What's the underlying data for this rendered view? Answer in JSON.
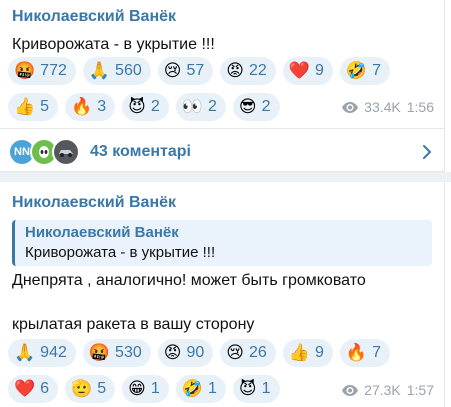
{
  "post1": {
    "author": "Николаевский Ванёк",
    "text": "Криворожата - в укрытие !!!",
    "reactions": [
      {
        "emoji": "🤬",
        "count": "772"
      },
      {
        "emoji": "🙏",
        "count": "560"
      },
      {
        "emoji": "😢",
        "count": "57"
      },
      {
        "emoji": "😡",
        "count": "22"
      },
      {
        "emoji": "❤️",
        "count": "9"
      },
      {
        "emoji": "🤣",
        "count": "7"
      },
      {
        "emoji": "👍",
        "count": "5"
      },
      {
        "emoji": "🔥",
        "count": "3"
      },
      {
        "emoji": "😈",
        "count": "2"
      },
      {
        "emoji": "👀",
        "count": "2"
      },
      {
        "emoji": "😎",
        "count": "2"
      }
    ],
    "views": "33.4K",
    "time": "1:56",
    "comments_label": "43 коментарі",
    "comment_avatars": [
      "NN",
      "",
      ""
    ]
  },
  "post2": {
    "author": "Николаевский Ванёк",
    "quote_author": "Николаевский Ванёк",
    "quote_text": "Криворожата - в укрытие !!!",
    "text_line1": "Днепрята , аналогично! может быть громковато",
    "text_line2": "крылатая ракета в вашу сторону",
    "reactions": [
      {
        "emoji": "🙏",
        "count": "942"
      },
      {
        "emoji": "🤬",
        "count": "530"
      },
      {
        "emoji": "😡",
        "count": "90"
      },
      {
        "emoji": "😢",
        "count": "26"
      },
      {
        "emoji": "👍",
        "count": "9"
      },
      {
        "emoji": "🔥",
        "count": "7"
      },
      {
        "emoji": "❤️",
        "count": "6"
      },
      {
        "emoji": "🫡",
        "count": "5"
      },
      {
        "emoji": "😁",
        "count": "1"
      },
      {
        "emoji": "🤣",
        "count": "1"
      },
      {
        "emoji": "😈",
        "count": "1"
      }
    ],
    "views": "27.3K",
    "time": "1:57"
  },
  "colors": {
    "accent": "#3a78a8",
    "reaction_bg": "#e9f1f8",
    "meta": "#9ba3aa"
  }
}
